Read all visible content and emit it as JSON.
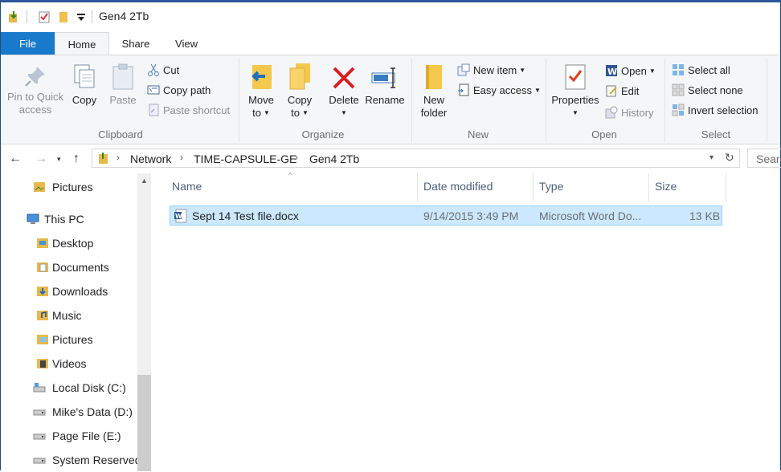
{
  "window": {
    "title": "Gen4 2Tb"
  },
  "ribbon_tabs": [
    {
      "label": "File"
    },
    {
      "label": "Home"
    },
    {
      "label": "Share"
    },
    {
      "label": "View"
    }
  ],
  "clipboard": {
    "group_label": "Clipboard",
    "pin_line1": "Pin to Quick",
    "pin_line2": "access",
    "copy": "Copy",
    "paste": "Paste",
    "cut": "Cut",
    "copy_path": "Copy path",
    "paste_shortcut": "Paste shortcut"
  },
  "organize": {
    "group_label": "Organize",
    "move_line1": "Move",
    "move_line2": "to",
    "copy_line1": "Copy",
    "copy_line2": "to",
    "delete": "Delete",
    "rename": "Rename"
  },
  "new": {
    "group_label": "New",
    "folder_line1": "New",
    "folder_line2": "folder",
    "new_item": "New item",
    "easy_access": "Easy access"
  },
  "open": {
    "group_label": "Open",
    "properties": "Properties",
    "open": "Open",
    "edit": "Edit",
    "history": "History"
  },
  "select": {
    "group_label": "Select",
    "select_all": "Select all",
    "select_none": "Select none",
    "invert_selection": "Invert selection"
  },
  "address": {
    "crumbs": [
      "Network",
      "TIME-CAPSULE-GE",
      "Gen4 2Tb"
    ],
    "search_placeholder": "Search"
  },
  "nav_pane": {
    "items": [
      {
        "label": "Pictures",
        "icon": "pictures-folder-icon"
      },
      {
        "label": "This PC",
        "icon": "this-pc-icon"
      },
      {
        "label": "Desktop",
        "icon": "desktop-folder-icon"
      },
      {
        "label": "Documents",
        "icon": "documents-folder-icon"
      },
      {
        "label": "Downloads",
        "icon": "downloads-folder-icon"
      },
      {
        "label": "Music",
        "icon": "music-folder-icon"
      },
      {
        "label": "Pictures",
        "icon": "pictures-folder-icon"
      },
      {
        "label": "Videos",
        "icon": "videos-folder-icon"
      },
      {
        "label": "Local Disk (C:)",
        "icon": "local-disk-icon"
      },
      {
        "label": "Mike's Data (D:)",
        "icon": "drive-icon"
      },
      {
        "label": "Page File (E:)",
        "icon": "drive-icon"
      },
      {
        "label": "System Reserved",
        "icon": "drive-icon"
      }
    ]
  },
  "file_list": {
    "columns": [
      "Name",
      "Date modified",
      "Type",
      "Size"
    ],
    "rows": [
      {
        "name": "Sept 14 Test file.docx",
        "date": "9/14/2015 3:49 PM",
        "type": "Microsoft Word Do...",
        "size": "13 KB",
        "icon": "word-document-icon",
        "selected": true
      }
    ]
  },
  "colors": {
    "accent": "#1979ca",
    "selection": "#cce8ff",
    "selection_border": "#99d1ff"
  }
}
